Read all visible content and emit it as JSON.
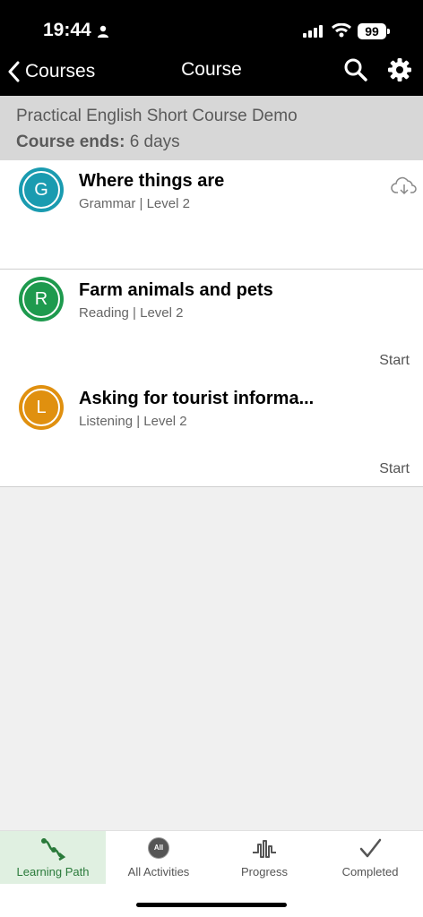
{
  "status": {
    "time": "19:44",
    "battery": "99"
  },
  "nav": {
    "back_label": "Courses",
    "title": "Course"
  },
  "course": {
    "name": "Practical English Short Course Demo",
    "ends_label": "Course ends:",
    "ends_value": "6 days"
  },
  "activities": [
    {
      "letter": "G",
      "title": "Where things are",
      "subtitle": "Grammar | Level 2",
      "action": "",
      "color": "#1a9bb0"
    },
    {
      "letter": "R",
      "title": "Farm animals and pets",
      "subtitle": "Reading | Level 2",
      "action": "Start",
      "color": "#1e9a4e"
    },
    {
      "letter": "L",
      "title": "Asking for tourist informa...",
      "subtitle": "Listening | Level 2",
      "action": "Start",
      "color": "#e0900f"
    }
  ],
  "tabs": [
    {
      "label": "Learning Path",
      "active": true
    },
    {
      "label": "All Activities",
      "icon_text": "All"
    },
    {
      "label": "Progress"
    },
    {
      "label": "Completed"
    }
  ],
  "colors": {
    "accent_green": "#2a7a3a",
    "active_tab_bg": "#e0f0e1"
  }
}
